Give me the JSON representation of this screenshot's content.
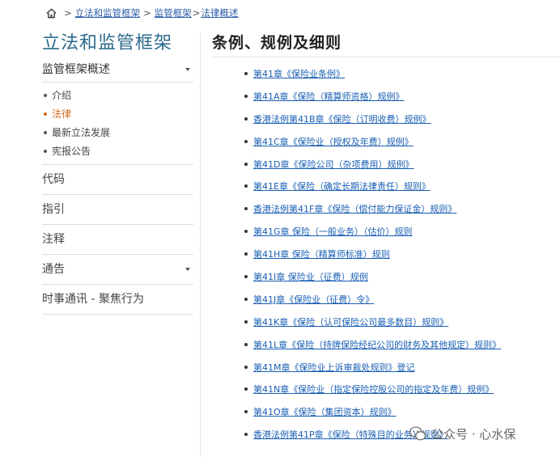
{
  "breadcrumb": {
    "level1": "立法和监管框架",
    "separator": ">",
    "level2": "监管框架",
    "level3": "法律概述"
  },
  "sidebar": {
    "title": "立法和监管框架",
    "overview": "监管框架概述",
    "sub_items": [
      {
        "label": "介绍",
        "active": false
      },
      {
        "label": "法律",
        "active": true
      },
      {
        "label": "最新立法发展",
        "active": false
      },
      {
        "label": "宪报公告",
        "active": false
      }
    ],
    "items": [
      {
        "label": "代码",
        "has_caret": false
      },
      {
        "label": "指引",
        "has_caret": false
      },
      {
        "label": "注释",
        "has_caret": false
      },
      {
        "label": "通告",
        "has_caret": true
      },
      {
        "label": "时事通讯 - 聚焦行为",
        "has_caret": false
      }
    ],
    "active_color": "#d2691e"
  },
  "main": {
    "title": "条例、规例及细则",
    "ordinances": [
      "第41章《保险业条例》",
      "第41A章《保险（精算师资格）规例》",
      "香港法例第41B章《保险（订明收费）规例》",
      "第41C章《保险业（授权及年费）规例》",
      "第41D章《保险公司（杂项费用）规例》",
      "第41E章《保险（确定长期法律责任）规则》",
      "香港法例第41F章《保险（偿付能力保证金）规则》",
      "第41G章 保险（一般业务）（估价）规则",
      "第41H章 保险（精算师标准）规则",
      "第41I章 保险业（征费）规例",
      "第41J章《保险业（征费）令》",
      "第41K章《保险（认可保险公司最多数目）规则》",
      "第41L章《保险（持牌保险经纪公司的财务及其他规定）规则》",
      "第41M章《保险业上诉审裁处规则》登记",
      "第41N章《保险业（指定保险控股公司的指定及年费）规例》",
      "第41O章《保险（集团资本）规则》",
      "香港法例第41P章《保险（特殊目的业务）规则》"
    ],
    "link_color": "#1a5fb4"
  },
  "watermark": {
    "text": "公众号 · 心水保"
  }
}
